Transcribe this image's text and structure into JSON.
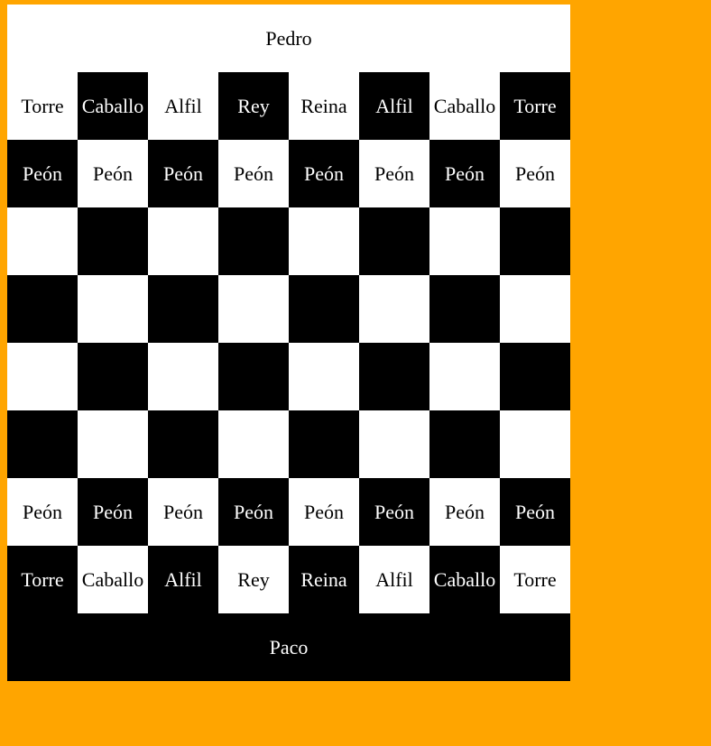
{
  "colors": {
    "page_background": "#FFA500",
    "light_square": "#ffffff",
    "dark_square": "#000000"
  },
  "players": {
    "top": "Pedro",
    "bottom": "Paco"
  },
  "board": {
    "rows": [
      [
        "Torre",
        "Caballo",
        "Alfil",
        "Rey",
        "Reina",
        "Alfil",
        "Caballo",
        "Torre"
      ],
      [
        "Peón",
        "Peón",
        "Peón",
        "Peón",
        "Peón",
        "Peón",
        "Peón",
        "Peón"
      ],
      [
        "",
        "",
        "",
        "",
        "",
        "",
        "",
        ""
      ],
      [
        "",
        "",
        "",
        "",
        "",
        "",
        "",
        ""
      ],
      [
        "",
        "",
        "",
        "",
        "",
        "",
        "",
        ""
      ],
      [
        "",
        "",
        "",
        "",
        "",
        "",
        "",
        ""
      ],
      [
        "Peón",
        "Peón",
        "Peón",
        "Peón",
        "Peón",
        "Peón",
        "Peón",
        "Peón"
      ],
      [
        "Torre",
        "Caballo",
        "Alfil",
        "Rey",
        "Reina",
        "Alfil",
        "Caballo",
        "Torre"
      ]
    ]
  }
}
